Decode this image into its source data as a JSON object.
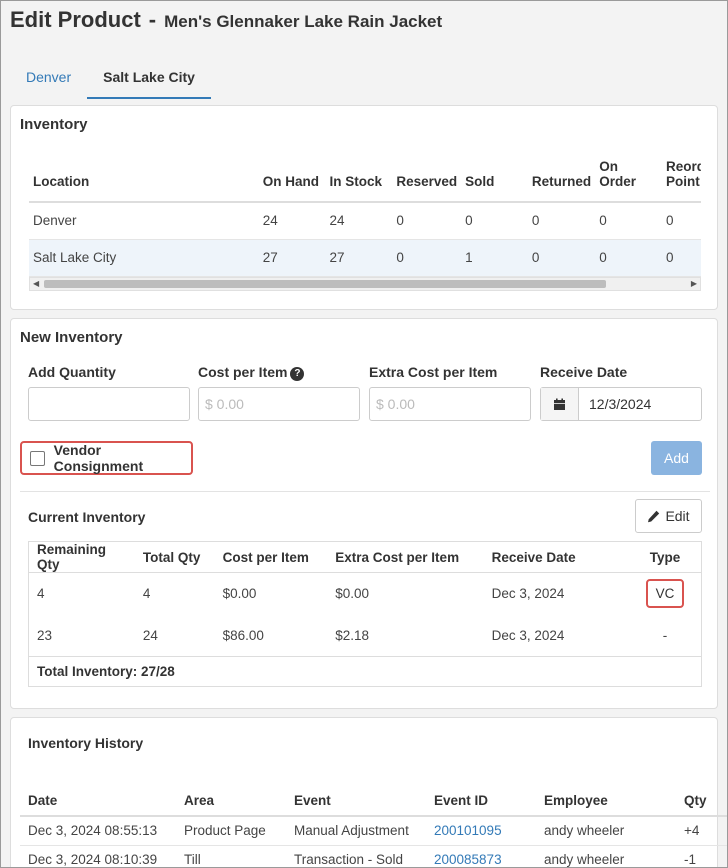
{
  "header": {
    "title": "Edit Product",
    "separator": "-",
    "product_name": "Men's Glennaker Lake Rain Jacket"
  },
  "tabs": [
    {
      "label": "Denver",
      "active": false
    },
    {
      "label": "Salt Lake City",
      "active": true
    }
  ],
  "inventory": {
    "title": "Inventory",
    "columns": [
      "Location",
      "On Hand",
      "In Stock",
      "Reserved",
      "Sold",
      "Returned",
      "On Order",
      "Reorder Point"
    ],
    "rows": [
      {
        "location": "Denver",
        "on_hand": "24",
        "in_stock": "24",
        "reserved": "0",
        "sold": "0",
        "returned": "0",
        "on_order": "0",
        "reorder": "0"
      },
      {
        "location": "Salt Lake City",
        "on_hand": "27",
        "in_stock": "27",
        "reserved": "0",
        "sold": "1",
        "returned": "0",
        "on_order": "0",
        "reorder": "0"
      }
    ]
  },
  "new_inventory": {
    "title": "New Inventory",
    "add_quantity_label": "Add Quantity",
    "add_quantity_value": "",
    "cost_label": "Cost per Item",
    "cost_placeholder": "$ 0.00",
    "extra_cost_label": "Extra Cost per Item",
    "extra_cost_placeholder": "$ 0.00",
    "receive_date_label": "Receive Date",
    "receive_date_value": "12/3/2024",
    "vendor_consignment_label": "Vendor Consignment",
    "vendor_consignment_checked": false,
    "add_button": "Add"
  },
  "current_inventory": {
    "title": "Current Inventory",
    "edit_button": "Edit",
    "columns": [
      "Remaining Qty",
      "Total Qty",
      "Cost per Item",
      "Extra Cost per Item",
      "Receive Date",
      "Type"
    ],
    "rows": [
      {
        "remaining": "4",
        "total": "4",
        "cost": "$0.00",
        "extra": "$0.00",
        "date": "Dec 3, 2024",
        "type": "VC"
      },
      {
        "remaining": "23",
        "total": "24",
        "cost": "$86.00",
        "extra": "$2.18",
        "date": "Dec 3, 2024",
        "type": "-"
      }
    ],
    "total": "Total Inventory: 27/28"
  },
  "history": {
    "title": "Inventory History",
    "columns": [
      "Date",
      "Area",
      "Event",
      "Event ID",
      "Employee",
      "Qty"
    ],
    "rows": [
      {
        "date": "Dec 3, 2024 08:55:13",
        "area": "Product Page",
        "event": "Manual Adjustment",
        "event_id": "200101095",
        "employee": "andy wheeler",
        "qty": "+4"
      },
      {
        "date": "Dec 3, 2024 08:10:39",
        "area": "Till",
        "event": "Transaction - Sold",
        "event_id": "200085873",
        "employee": "andy wheeler",
        "qty": "-1"
      }
    ]
  },
  "colors": {
    "link": "#337ab7",
    "highlight_border": "#d9534f",
    "add_button_disabled": "#8ab4e0"
  }
}
